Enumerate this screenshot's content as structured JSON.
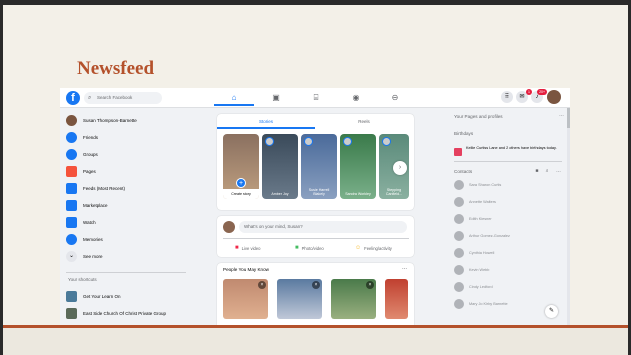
{
  "slide": {
    "title": "Newsfeed"
  },
  "topbar": {
    "search_placeholder": "Search Facebook",
    "logo_glyph": "f",
    "nav": [
      "home-icon",
      "watch-icon",
      "marketplace-icon",
      "groups-icon",
      "gaming-icon"
    ],
    "notification_badges": [
      "1",
      "20+"
    ]
  },
  "left": {
    "items": [
      {
        "label": "Susan Thompson-Barnette",
        "color": "#7a5540"
      },
      {
        "label": "Friends",
        "color": "#1877f2"
      },
      {
        "label": "Groups",
        "color": "#1877f2"
      },
      {
        "label": "Pages",
        "color": "#f5533d"
      },
      {
        "label": "Feeds (Most Recent)",
        "color": "#1877f2"
      },
      {
        "label": "Marketplace",
        "color": "#1877f2"
      },
      {
        "label": "Watch",
        "color": "#1877f2"
      },
      {
        "label": "Memories",
        "color": "#1877f2"
      },
      {
        "label": "See more",
        "color": "#e4e6eb"
      }
    ],
    "shortcuts_title": "Your shortcuts",
    "shortcuts": [
      {
        "label": "Get Your Learn On",
        "color": "#4a7a9a"
      },
      {
        "label": "East Side Church Of Christ Private Group",
        "color": "#5a6a5a"
      }
    ]
  },
  "stories": {
    "tabs": [
      "Stories",
      "Reels"
    ],
    "cards": [
      {
        "name": "Create story",
        "color": "#a08070"
      },
      {
        "name": "Amber Joy",
        "color": "#4a5a6a"
      },
      {
        "name": "Susie Harrell Blakely",
        "color": "#5a7aa0"
      },
      {
        "name": "Sandra Workley",
        "color": "#4a8a5a"
      },
      {
        "name": "Stepping Canfield...",
        "color": "#6a8a7a"
      }
    ]
  },
  "composer": {
    "placeholder": "What's on your mind, Susan?",
    "live": "Live video",
    "photo": "Photo/video",
    "feeling": "Feeling/activity"
  },
  "pymk": {
    "title": "People You May Know",
    "more": "..."
  },
  "right": {
    "pages_title": "Your Pages and profiles",
    "birthdays_title": "Birthdays",
    "birthday_text": "Kellie Curtiss Lane and 2 others have birthdays today.",
    "contacts_title": "Contacts",
    "contacts": [
      "Sara Sharon Curtis",
      "Annette Walters",
      "Edith Kiesner",
      "Arthur Gomez-Gonzalez",
      "Cynthia Howell",
      "Kevin Webb",
      "Cindy Ledford",
      "Mary Jo Kirby Barnette"
    ]
  }
}
